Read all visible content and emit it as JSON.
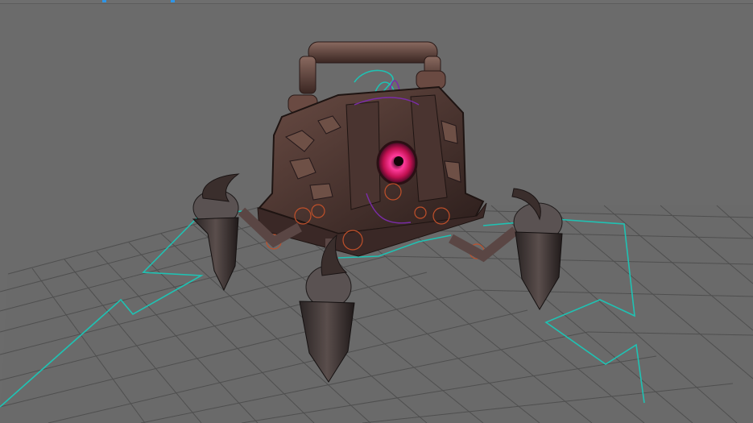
{
  "viewport": {
    "background_color": "#6b6b6b",
    "grid_color": "#4e4e4e",
    "rig_curve_color": "#1fc2b3",
    "joint_color": "#c0502a",
    "eye_color": "#e0206a",
    "selection_color": "#7a2ca8"
  },
  "top_strip": {
    "indicator_color": "#2f95e6",
    "icons": [
      "top-indicator-icon",
      "top-indicator-icon"
    ]
  },
  "scene": {
    "model": "stone-spider-golem",
    "grid": true,
    "rig_controls_visible": true
  }
}
